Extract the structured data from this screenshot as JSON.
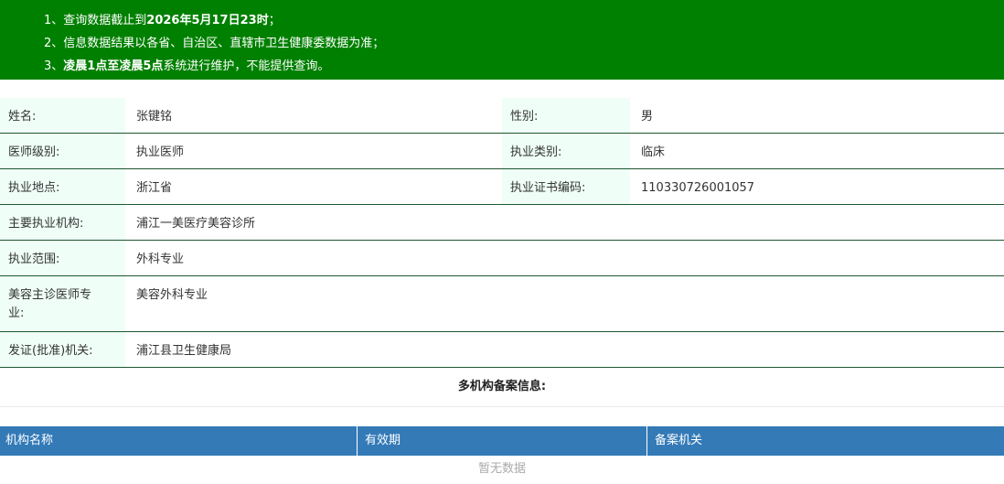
{
  "notice": {
    "line1_prefix": "1、查询数据截止到",
    "line1_bold": "2026年5月17日23时",
    "line1_suffix": "；",
    "line2": "2、信息数据结果以各省、自治区、直辖市卫生健康委数据为准；",
    "line3_prefix": "3、",
    "line3_bold": "凌晨1点至凌晨5点",
    "line3_suffix": "系统进行维护，不能提供查询。"
  },
  "info": {
    "name_label": "姓名:",
    "name_value": "张键铭",
    "gender_label": "性别:",
    "gender_value": "男",
    "level_label": "医师级别:",
    "level_value": "执业医师",
    "category_label": "执业类别:",
    "category_value": "临床",
    "location_label": "执业地点:",
    "location_value": "浙江省",
    "cert_label": "执业证书编码:",
    "cert_value": "110330726001057",
    "org_label": "主要执业机构:",
    "org_value": "浦江一美医疗美容诊所",
    "scope_label": "执业范围:",
    "scope_value": "外科专业",
    "cosmetic_label": "美容主诊医师专业:",
    "cosmetic_value": "美容外科专业",
    "issuer_label": "发证(批准)机关:",
    "issuer_value": "浦江县卫生健康局"
  },
  "multi": {
    "title": "多机构备案信息:",
    "columns": [
      "机构名称",
      "有效期",
      "备案机关"
    ],
    "empty_text": "暂无数据"
  },
  "colors": {
    "notice_bg": "#008000",
    "label_bg": "#effff7",
    "header_bg": "#337ab7"
  }
}
